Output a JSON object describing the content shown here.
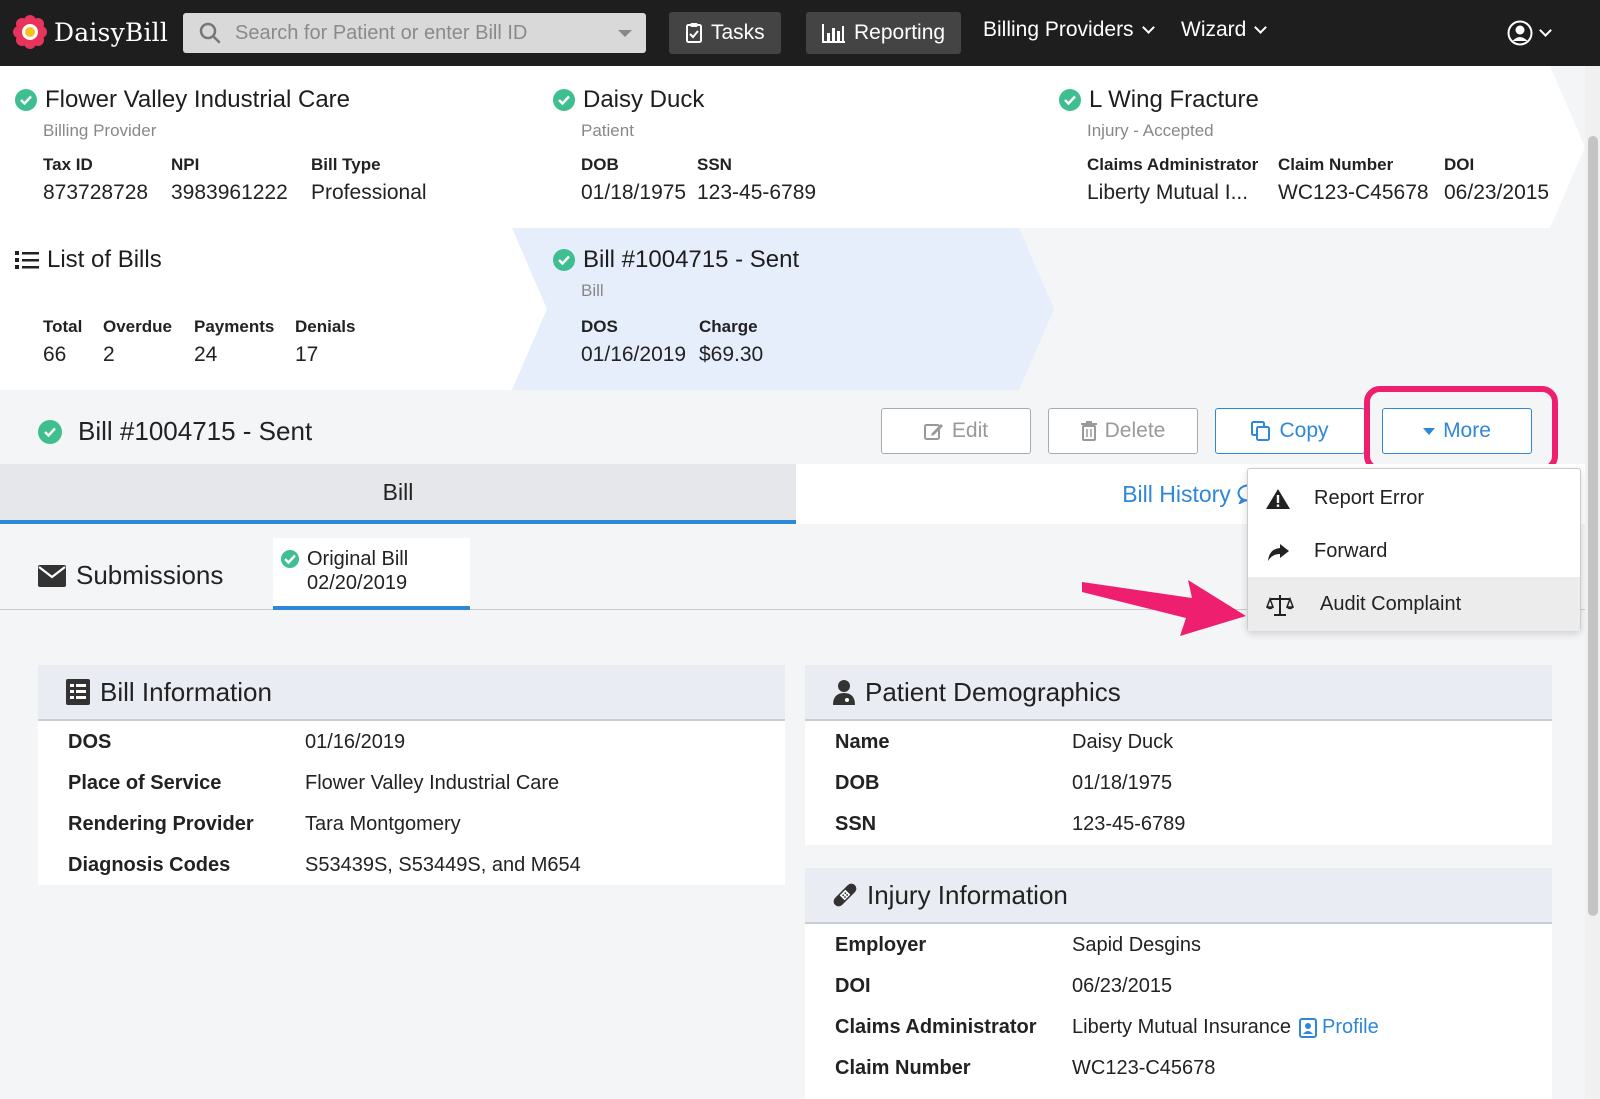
{
  "nav": {
    "brand": "DaisyBill",
    "search_placeholder": "Search for Patient or enter Bill ID",
    "tasks": "Tasks",
    "reporting": "Reporting",
    "billing_providers": "Billing Providers",
    "wizard": "Wizard"
  },
  "crumbs": {
    "provider": {
      "title": "Flower Valley Industrial Care",
      "subtitle": "Billing Provider",
      "fields": [
        {
          "label": "Tax ID",
          "value": "873728728"
        },
        {
          "label": "NPI",
          "value": "3983961222"
        },
        {
          "label": "Bill Type",
          "value": "Professional"
        }
      ]
    },
    "patient": {
      "title": "Daisy Duck",
      "subtitle": "Patient",
      "fields": [
        {
          "label": "DOB",
          "value": "01/18/1975"
        },
        {
          "label": "SSN",
          "value": "123-45-6789"
        }
      ]
    },
    "injury": {
      "title": "L Wing Fracture",
      "subtitle": "Injury - Accepted",
      "fields": [
        {
          "label": "Claims Administrator",
          "value": "Liberty Mutual I..."
        },
        {
          "label": "Claim Number",
          "value": "WC123-C45678"
        },
        {
          "label": "DOI",
          "value": "06/23/2015"
        }
      ]
    },
    "bills": {
      "title": "List of Bills",
      "fields": [
        {
          "label": "Total",
          "value": "66"
        },
        {
          "label": "Overdue",
          "value": "2"
        },
        {
          "label": "Payments",
          "value": "24"
        },
        {
          "label": "Denials",
          "value": "17"
        }
      ]
    },
    "bill": {
      "title": "Bill #1004715 - Sent",
      "subtitle": "Bill",
      "fields": [
        {
          "label": "DOS",
          "value": "01/16/2019"
        },
        {
          "label": "Charge",
          "value": "$69.30"
        }
      ]
    }
  },
  "bill_header": {
    "title": "Bill #1004715 - Sent",
    "edit": "Edit",
    "delete": "Delete",
    "copy": "Copy",
    "more": "More"
  },
  "tabs": {
    "bill": "Bill",
    "history": "Bill History"
  },
  "submissions": {
    "title": "Submissions",
    "original_line1": "Original Bill",
    "original_line2": "02/20/2019"
  },
  "more_menu": {
    "items": [
      "Report Error",
      "Forward",
      "Audit Complaint"
    ],
    "highlighted": "Audit Complaint"
  },
  "bill_info": {
    "title": "Bill Information",
    "rows": [
      {
        "label": "DOS",
        "value": "01/16/2019"
      },
      {
        "label": "Place of Service",
        "value": "Flower Valley Industrial Care"
      },
      {
        "label": "Rendering Provider",
        "value": "Tara Montgomery"
      },
      {
        "label": "Diagnosis Codes",
        "value": "S53439S, S53449S, and M654"
      }
    ]
  },
  "patient_demo": {
    "title": "Patient Demographics",
    "rows": [
      {
        "label": "Name",
        "value": "Daisy Duck"
      },
      {
        "label": "DOB",
        "value": "01/18/1975"
      },
      {
        "label": "SSN",
        "value": "123-45-6789"
      }
    ]
  },
  "injury_info": {
    "title": "Injury Information",
    "rows": [
      {
        "label": "Employer",
        "value": "Sapid Desgins"
      },
      {
        "label": "DOI",
        "value": "06/23/2015"
      },
      {
        "label": "Claims Administrator",
        "value": "Liberty Mutual Insurance"
      },
      {
        "label": "Claim Number",
        "value": "WC123-C45678"
      }
    ],
    "profile_link": "Profile"
  },
  "colors": {
    "accent": "#2f87d8",
    "success": "#3fbf8f",
    "highlight": "#ee1f6e"
  }
}
